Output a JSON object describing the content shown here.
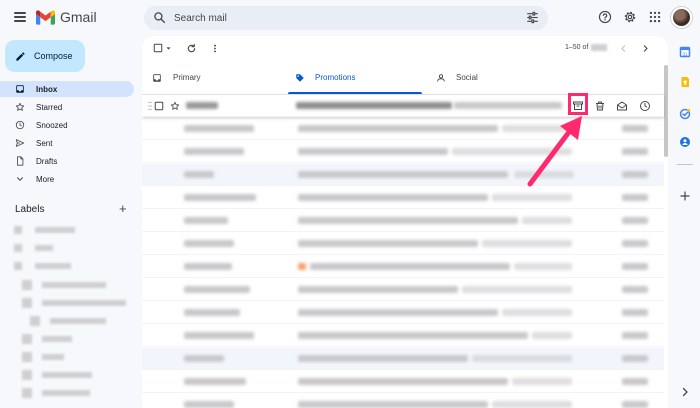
{
  "app": {
    "name": "Gmail"
  },
  "search": {
    "placeholder": "Search mail"
  },
  "sidebar": {
    "compose_label": "Compose",
    "items": [
      {
        "label": "Inbox",
        "icon": "inbox-icon",
        "active": true
      },
      {
        "label": "Starred",
        "icon": "star-icon"
      },
      {
        "label": "Snoozed",
        "icon": "clock-icon"
      },
      {
        "label": "Sent",
        "icon": "send-icon"
      },
      {
        "label": "Drafts",
        "icon": "draft-icon"
      },
      {
        "label": "More",
        "icon": "chevron-down-icon"
      }
    ],
    "labels_title": "Labels",
    "labels_add": "+"
  },
  "toolbar": {
    "pager_text": "1–50 of"
  },
  "tabs": [
    {
      "label": "Primary",
      "icon": "inbox-icon",
      "active": false
    },
    {
      "label": "Promotions",
      "icon": "tag-icon",
      "active": true
    },
    {
      "label": "Social",
      "icon": "people-icon",
      "active": false
    }
  ],
  "hover_actions": [
    "archive-icon",
    "trash-icon",
    "mark-unread-icon",
    "snooze-icon"
  ],
  "colors": {
    "accent": "#0b57d0",
    "compose_bg": "#c2e7ff",
    "active_nav": "#d3e3fd",
    "highlight": "#ff2a6d",
    "promo_tag": "#0b57d0"
  }
}
